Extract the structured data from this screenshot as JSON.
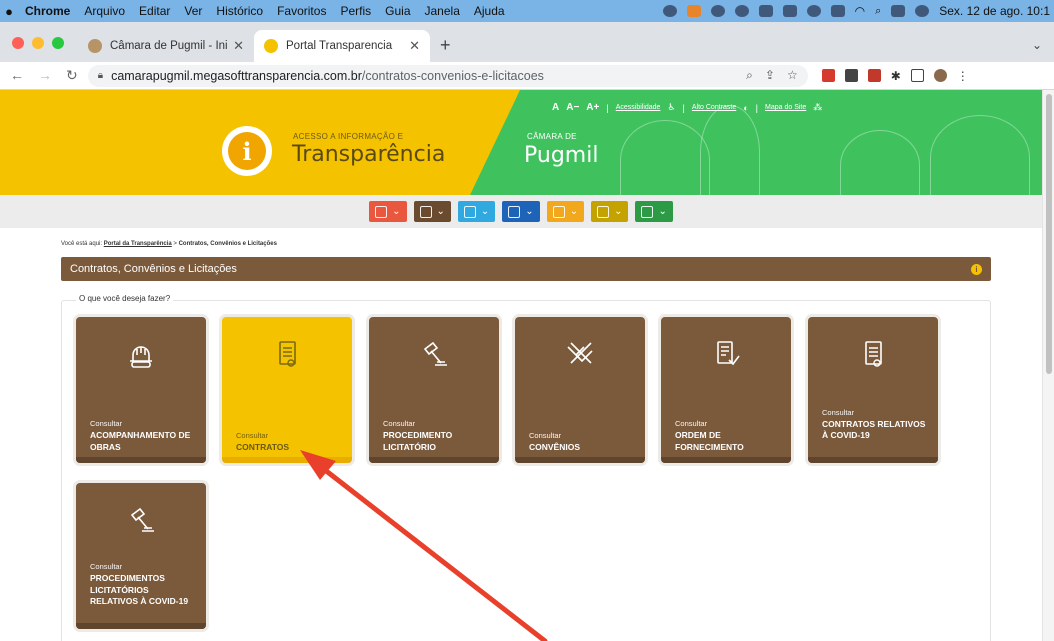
{
  "menubar": {
    "app": "Chrome",
    "items": [
      "Arquivo",
      "Editar",
      "Ver",
      "Histórico",
      "Favoritos",
      "Perfis",
      "Guia",
      "Janela",
      "Ajuda"
    ],
    "clock": "Sex. 12 de ago. 10:1"
  },
  "tabs": [
    {
      "title": "Câmara de Pugmil - Inicial"
    },
    {
      "title": "Portal Transparencia"
    }
  ],
  "address": {
    "domain": "camarapugmil.megasofttransparencia.com.br",
    "path": "/contratos-convenios-e-licitacoes"
  },
  "banner": {
    "acesso_label": "ACESSO A INFORMAÇÃO E",
    "brand": "Transparência",
    "camara_label": "CÂMARA DE",
    "city": "Pugmil",
    "font_a": "A",
    "font_minus": "A−",
    "font_plus": "A+",
    "accessibility": "Acessibilidade",
    "contrast": "Alto Contraste",
    "sitemap": "Mapa do Site"
  },
  "iconnav": [
    {
      "name": "nav-planejamento",
      "color": "#e9573f"
    },
    {
      "name": "nav-contratos",
      "color": "#6b4b30"
    },
    {
      "name": "nav-pessoal",
      "color": "#2fa9e0"
    },
    {
      "name": "nav-financeiro",
      "color": "#1d63b8"
    },
    {
      "name": "nav-documentos",
      "color": "#f2a81d"
    },
    {
      "name": "nav-legislacao",
      "color": "#c4a300"
    },
    {
      "name": "nav-receitas",
      "color": "#2d9b46"
    }
  ],
  "breadcrumb": {
    "prefix": "Você está aqui:",
    "portal": "Portal da Transparência",
    "sep": ">",
    "current": "Contratos, Convênios e Licitações"
  },
  "section": {
    "title": "Contratos, Convênios e Licitações",
    "info": "i"
  },
  "fieldset": {
    "legend": "O que você deseja fazer?"
  },
  "cards": [
    {
      "sub": "Consultar",
      "title": "ACOMPANHAMENTO DE OBRAS",
      "icon": "hardhat-icon"
    },
    {
      "sub": "Consultar",
      "title": "CONTRATOS",
      "icon": "document-icon",
      "active": true
    },
    {
      "sub": "Consultar",
      "title": "PROCEDIMENTO LICITATÓRIO",
      "icon": "gavel-icon"
    },
    {
      "sub": "Consultar",
      "title": "CONVÊNIOS",
      "icon": "handshake-icon"
    },
    {
      "sub": "Consultar",
      "title": "ORDEM DE FORNECIMENTO",
      "icon": "order-icon"
    },
    {
      "sub": "Consultar",
      "title": "CONTRATOS RELATIVOS À COVID-19",
      "icon": "document-icon"
    },
    {
      "sub": "Consultar",
      "title": "PROCEDIMENTOS LICITATÓRIOS RELATIVOS À COVID-19",
      "icon": "gavel-icon"
    }
  ],
  "colors": {
    "brown": "#7b5a3c",
    "yellow": "#f5c200",
    "green": "#3fc25e",
    "annotation_arrow": "#e8402b"
  }
}
